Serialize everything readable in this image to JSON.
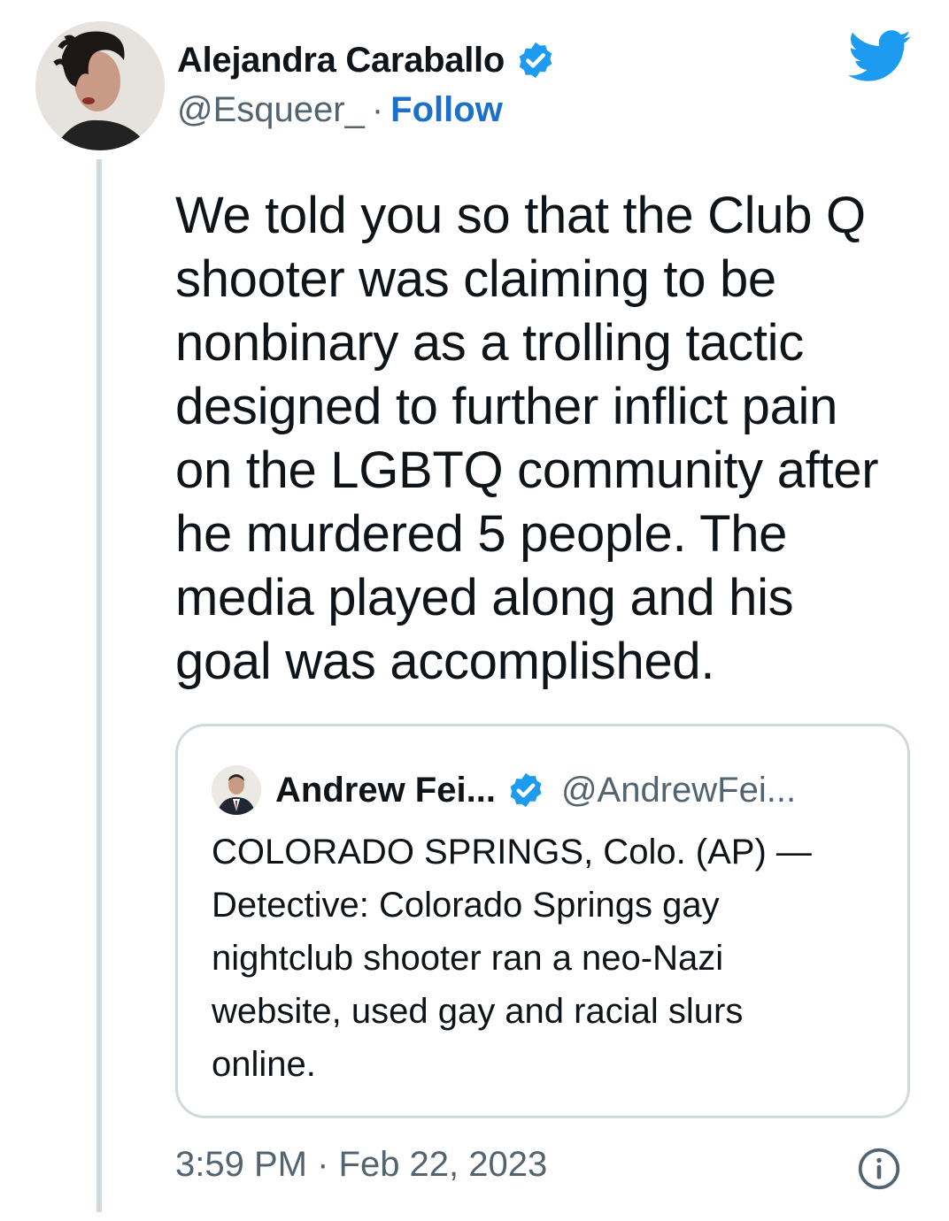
{
  "tweet": {
    "author_name": "Alejandra Caraballo",
    "author_handle": "@Esqueer_",
    "separator": "·",
    "follow_label": "Follow",
    "text": "We told you so that the Club Q\nshooter was claiming to be\nnonbinary as a trolling tactic\ndesigned to further inflict pain\non the LGBTQ community after\nhe murdered 5 people. The\nmedia played along and his\ngoal was accomplished.",
    "timestamp": "3:59 PM · Feb 22, 2023",
    "icons": [
      "avatar",
      "verified-badge-icon",
      "twitter-bird-icon",
      "info-icon"
    ]
  },
  "quote": {
    "author_name": "Andrew Fei...",
    "author_handle": "@AndrewFei...",
    "text": "COLORADO SPRINGS, Colo. (AP) —\nDetective: Colorado Springs gay\nnightclub shooter ran a neo-Nazi\nwebsite, used gay and racial slurs\nonline."
  },
  "colors": {
    "accent": "#1d9bf0",
    "follow": "#1d70c8",
    "secondary_text": "#536471",
    "border": "#cfd9de"
  }
}
